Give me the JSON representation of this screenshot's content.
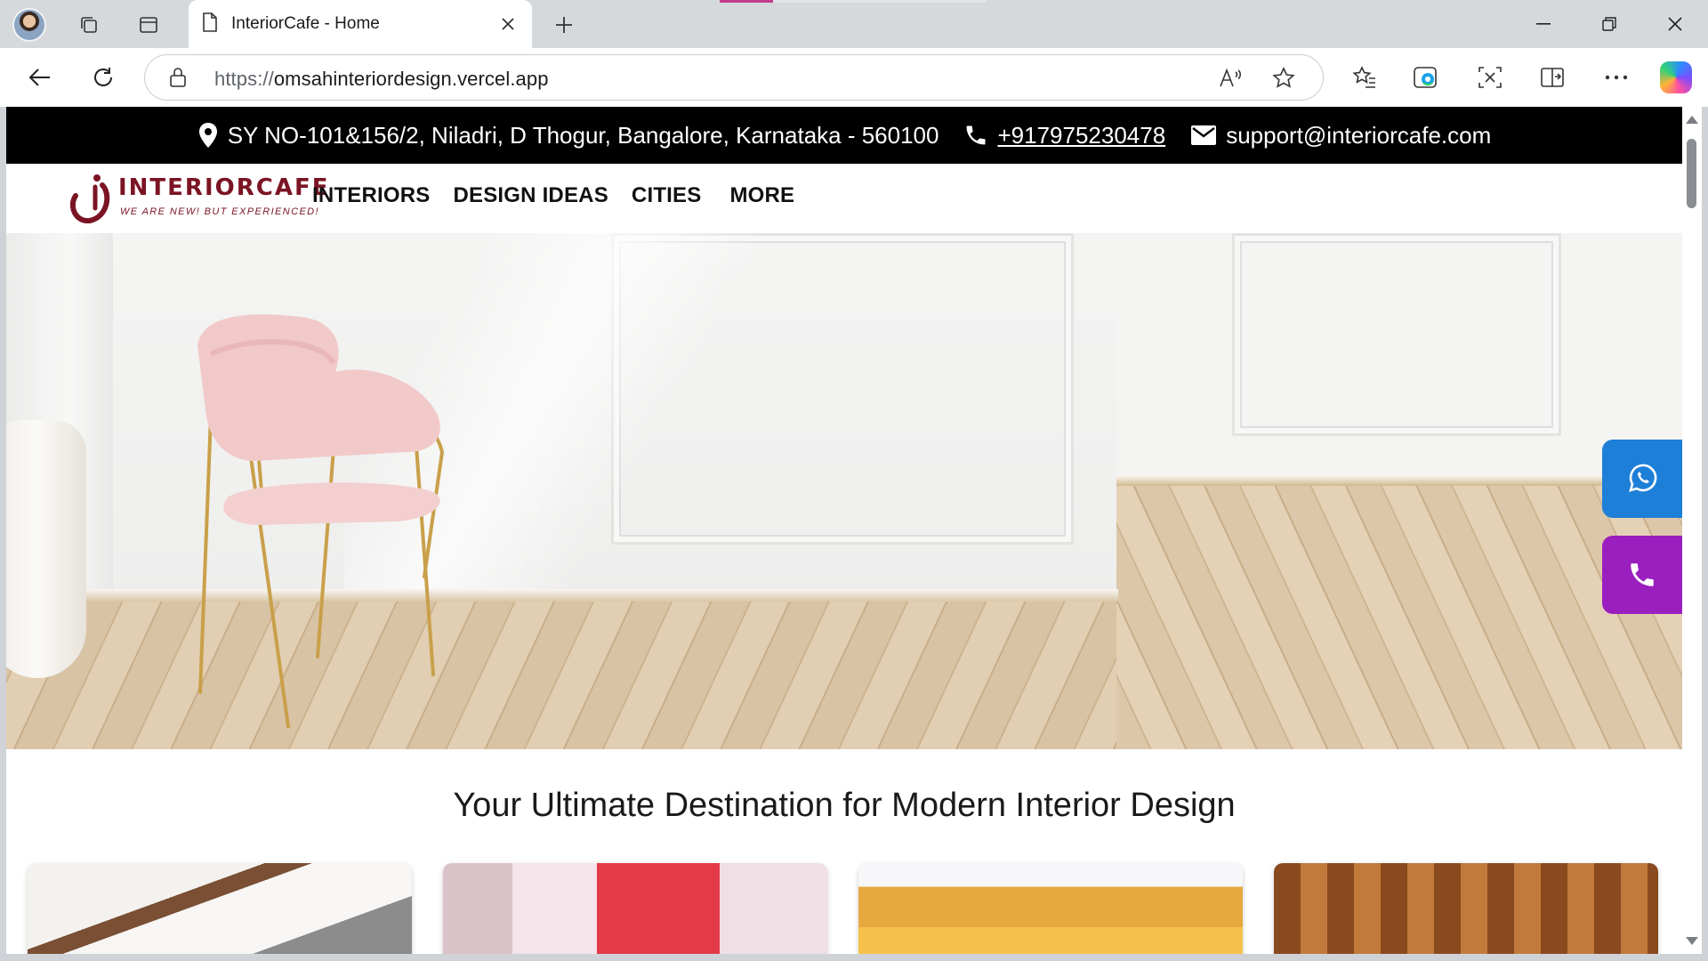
{
  "browser": {
    "tab_title": "InteriorCafe - Home",
    "url_protocol": "https://",
    "url_host": "omsahinteriordesign.vercel.app"
  },
  "topbar": {
    "address": "SY NO-101&156/2, Niladri, D Thogur, Bangalore, Karnataka - 560100",
    "phone": "+917975230478",
    "email": "support@interiorcafe.com"
  },
  "logo": {
    "name": "INTERIORCAFE",
    "tagline": "WE ARE NEW! BUT EXPERIENCED!"
  },
  "menu": [
    "INTERIORS",
    "DESIGN IDEAS",
    "CITIES",
    "MORE"
  ],
  "headline": "Your Ultimate Destination for Modern Interior Design",
  "floating": {
    "whatsapp_color": "#1e7fd8",
    "call_color": "#9b1fbf"
  },
  "colors": {
    "brand": "#7b1424",
    "topbar_bg": "#000000"
  }
}
